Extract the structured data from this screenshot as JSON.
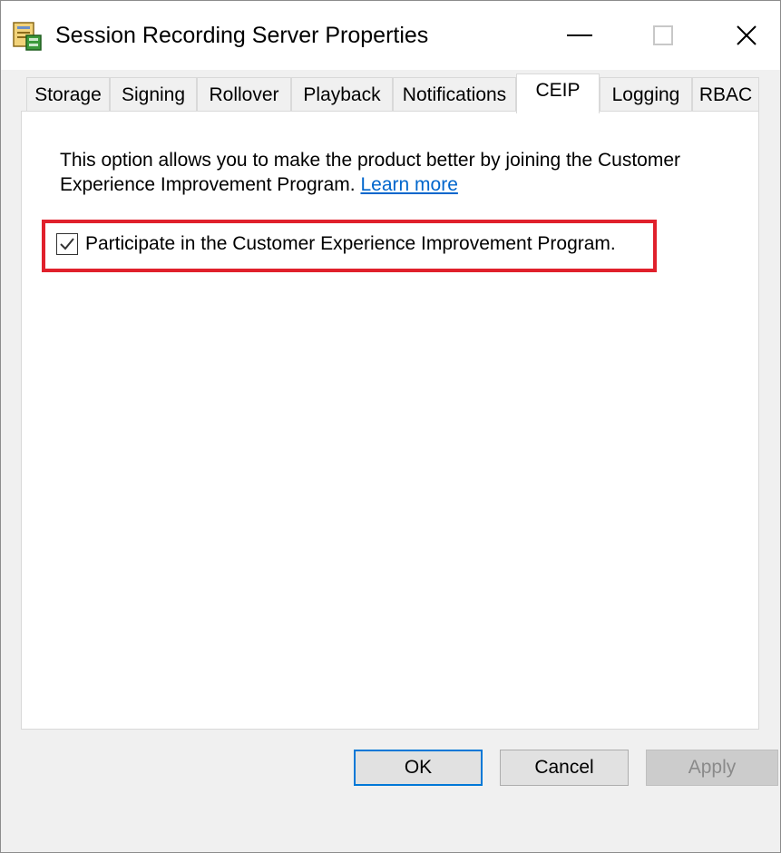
{
  "window": {
    "title": "Session Recording Server Properties",
    "app_icon": "server-properties-icon",
    "controls": {
      "minimize_icon": "minimize-icon",
      "maximize_icon": "maximize-icon",
      "close_icon": "close-icon"
    }
  },
  "tabs": [
    {
      "label": "Storage",
      "active": false
    },
    {
      "label": "Signing",
      "active": false
    },
    {
      "label": "Rollover",
      "active": false
    },
    {
      "label": "Playback",
      "active": false
    },
    {
      "label": "Notifications",
      "active": false
    },
    {
      "label": "CEIP",
      "active": true
    },
    {
      "label": "Logging",
      "active": false
    },
    {
      "label": "RBAC",
      "active": false
    }
  ],
  "ceip": {
    "description": "This option allows you to make the product better by joining the Customer Experience Improvement Program.",
    "learn_more": "Learn more",
    "checkbox_label": "Participate in the Customer Experience Improvement Program.",
    "checked": true
  },
  "buttons": {
    "ok": "OK",
    "cancel": "Cancel",
    "apply": "Apply"
  },
  "colors": {
    "highlight": "#e0202c",
    "link": "#0066cc",
    "default_button_border": "#0078d7"
  }
}
